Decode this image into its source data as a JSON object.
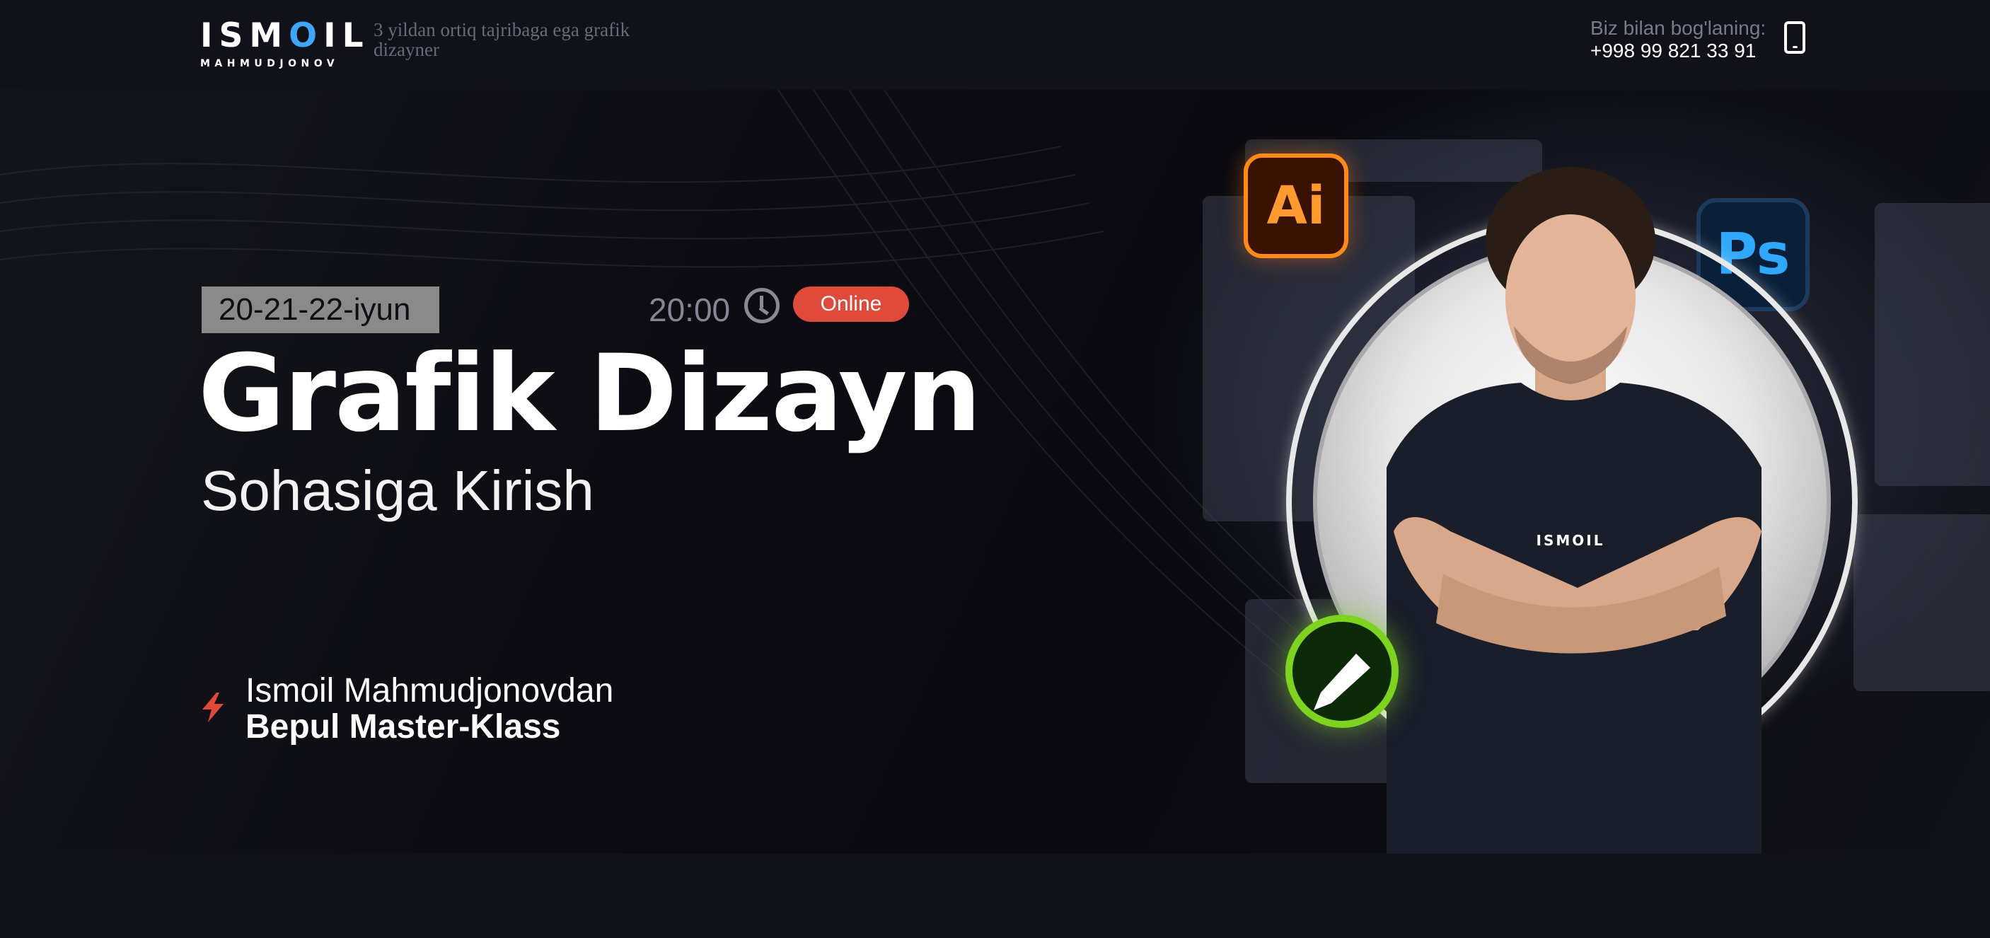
{
  "header": {
    "logo_main": "ISMOIL",
    "logo_sub": "MAHMUDJONOV",
    "tagline": "3 yildan ortiq tajribaga ega grafik dizayner",
    "contact_label": "Biz bilan bog'laning:",
    "contact_phone": "+998 99 821 33 91"
  },
  "hero": {
    "date": "20-21-22-iyun",
    "time": "20:00",
    "online_badge": "Online",
    "title": "Grafik Dizayn",
    "subtitle": "Sohasiga Kirish",
    "host": "Ismoil Mahmudjonovdan",
    "master_class": "Bepul Master-Klass",
    "ai_logo": "Ai",
    "ps_logo": "Ps",
    "shirt_logo": "ISMOIL"
  },
  "colors": {
    "background": "#0e0e16",
    "accent_red": "#e04a3a",
    "logo_blue": "#3ea6ff",
    "illustrator_orange": "#ff8a1a",
    "photoshop_blue": "#31a8ff",
    "corel_green": "#7ed321"
  },
  "icons": [
    "phone-icon",
    "clock-icon",
    "bolt-icon",
    "illustrator-icon",
    "photoshop-icon",
    "coreldraw-icon"
  ]
}
